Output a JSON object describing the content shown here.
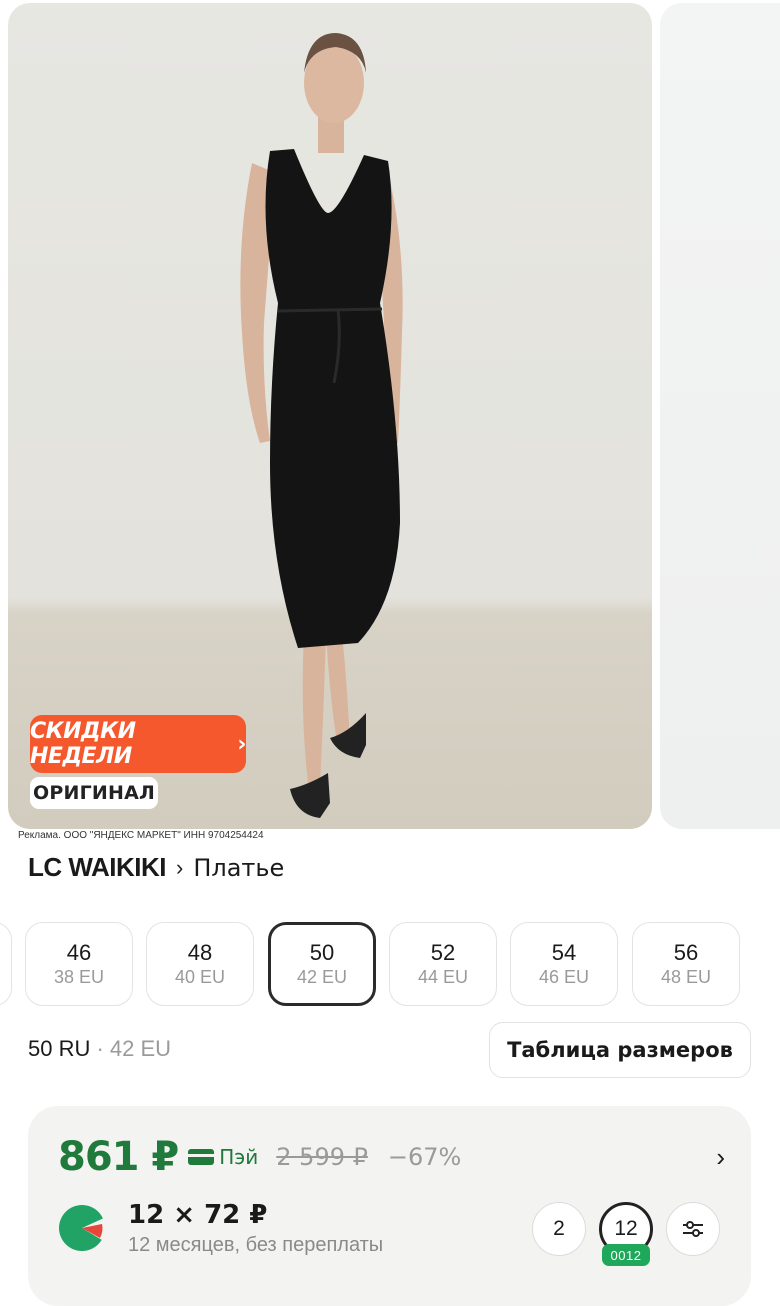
{
  "promo": {
    "label": "Скидки недели",
    "chevron": "›"
  },
  "badge": {
    "label": "ОРИГИНАЛ"
  },
  "ad_disclaimer": "Реклама. ООО \"ЯНДЕКС МАРКЕТ\" ИНН 9704254424",
  "breadcrumb": {
    "brand": "LC WAIKIKI",
    "separator": "›",
    "category": "Платье"
  },
  "sizes": [
    {
      "ru": "46",
      "eu": "38 EU",
      "selected": false
    },
    {
      "ru": "48",
      "eu": "40 EU",
      "selected": false
    },
    {
      "ru": "50",
      "eu": "42 EU",
      "selected": true
    },
    {
      "ru": "52",
      "eu": "44 EU",
      "selected": false
    },
    {
      "ru": "54",
      "eu": "46 EU",
      "selected": false
    },
    {
      "ru": "56",
      "eu": "48 EU",
      "selected": false
    }
  ],
  "selected_size": {
    "ru": "50 RU",
    "dot": " · ",
    "eu": "42 EU"
  },
  "size_table_button": "Таблица размеров",
  "price": {
    "current": "861 ₽",
    "pay_label": "Пэй",
    "old": "2 599 ₽",
    "discount": "−67%",
    "chevron": "›"
  },
  "split": {
    "amount": "12 × 72 ₽",
    "description": "12 месяцев, без переплаты",
    "terms": [
      {
        "label": "2",
        "selected": false
      },
      {
        "label": "12",
        "selected": true
      }
    ],
    "term_tag": "0012"
  },
  "colors": {
    "accent_green": "#1f7a3b",
    "promo_orange": "#f5582c",
    "tag_green": "#1fa85a"
  },
  "icons": [
    "card-icon",
    "split-logo-icon",
    "filter-settings-icon",
    "chevron-right-icon"
  ]
}
